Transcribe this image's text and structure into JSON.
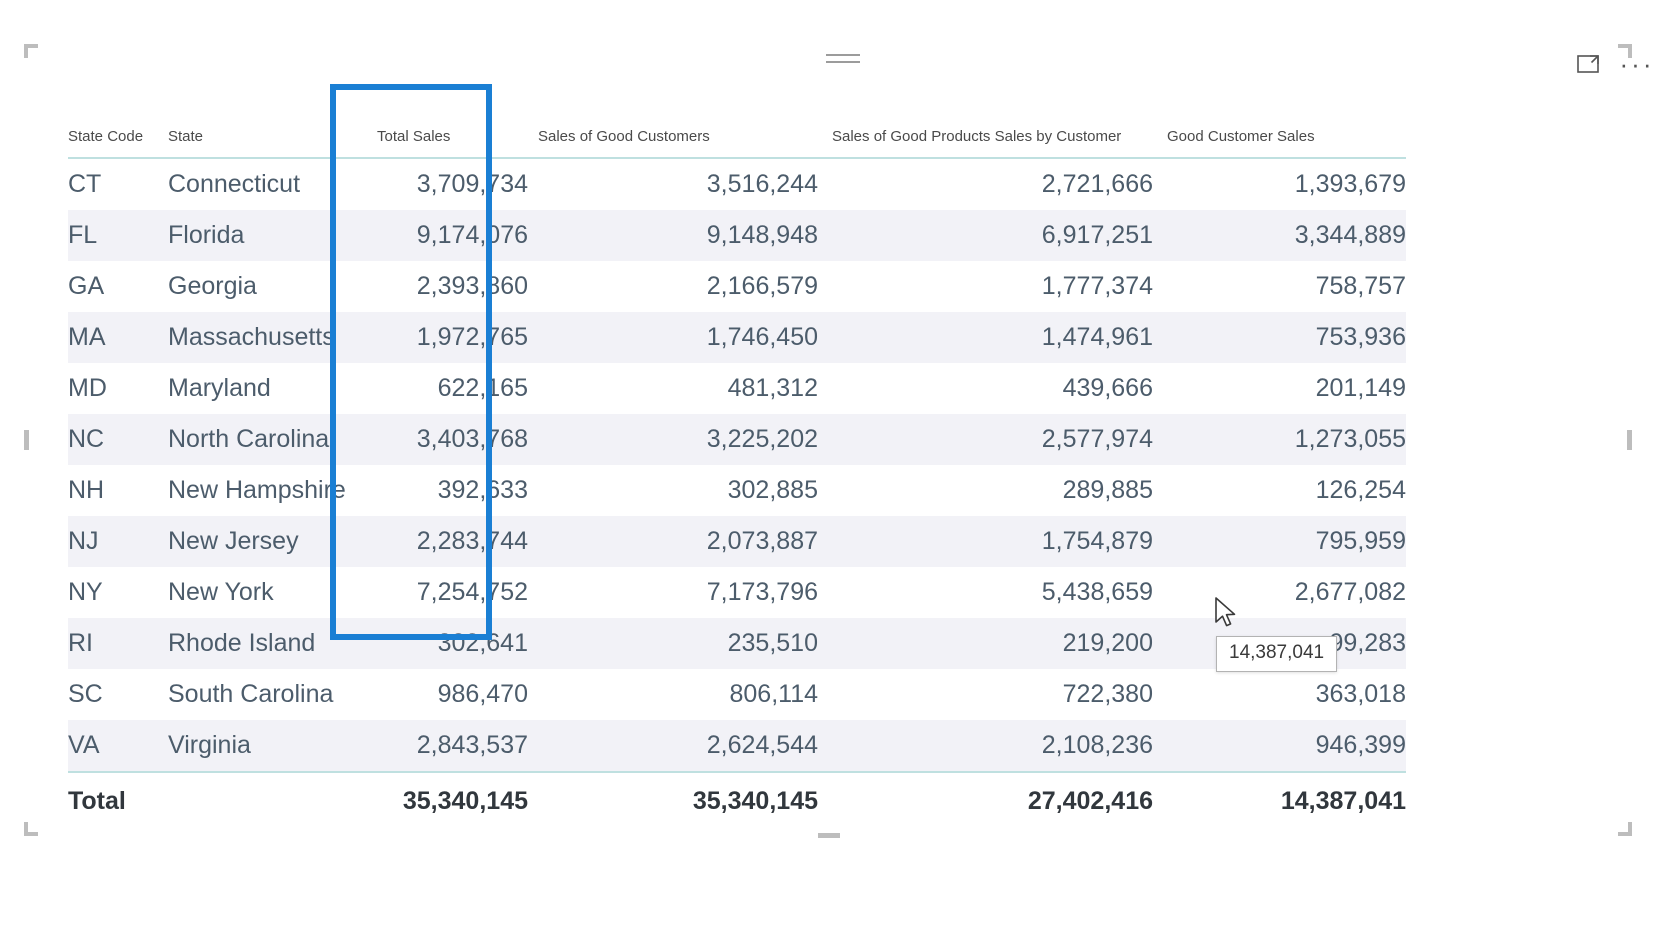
{
  "visual": {
    "drag_grip_name": "drag-handle",
    "focus_mode_label": "Focus mode",
    "more_options_label": "More options",
    "more_options_glyph": "···"
  },
  "table": {
    "columns": [
      {
        "key": "state_code",
        "label": "State Code",
        "align": "left"
      },
      {
        "key": "state",
        "label": "State",
        "align": "left"
      },
      {
        "key": "total_sales",
        "label": "Total Sales",
        "align": "right"
      },
      {
        "key": "sales_of_good_customers",
        "label": "Sales of Good Customers",
        "align": "right"
      },
      {
        "key": "sales_of_good_products_sales_by_customer",
        "label": "Sales of Good Products Sales by Customer",
        "align": "right"
      },
      {
        "key": "good_customer_sales",
        "label": "Good Customer Sales",
        "align": "right"
      }
    ],
    "rows": [
      {
        "state_code": "CT",
        "state": "Connecticut",
        "total_sales": "3,709,734",
        "sales_of_good_customers": "3,516,244",
        "sales_of_good_products_sales_by_customer": "2,721,666",
        "good_customer_sales": "1,393,679"
      },
      {
        "state_code": "FL",
        "state": "Florida",
        "total_sales": "9,174,076",
        "sales_of_good_customers": "9,148,948",
        "sales_of_good_products_sales_by_customer": "6,917,251",
        "good_customer_sales": "3,344,889"
      },
      {
        "state_code": "GA",
        "state": "Georgia",
        "total_sales": "2,393,860",
        "sales_of_good_customers": "2,166,579",
        "sales_of_good_products_sales_by_customer": "1,777,374",
        "good_customer_sales": "758,757"
      },
      {
        "state_code": "MA",
        "state": "Massachusetts",
        "total_sales": "1,972,765",
        "sales_of_good_customers": "1,746,450",
        "sales_of_good_products_sales_by_customer": "1,474,961",
        "good_customer_sales": "753,936"
      },
      {
        "state_code": "MD",
        "state": "Maryland",
        "total_sales": "622,165",
        "sales_of_good_customers": "481,312",
        "sales_of_good_products_sales_by_customer": "439,666",
        "good_customer_sales": "201,149"
      },
      {
        "state_code": "NC",
        "state": "North Carolina",
        "total_sales": "3,403,768",
        "sales_of_good_customers": "3,225,202",
        "sales_of_good_products_sales_by_customer": "2,577,974",
        "good_customer_sales": "1,273,055"
      },
      {
        "state_code": "NH",
        "state": "New Hampshire",
        "total_sales": "392,633",
        "sales_of_good_customers": "302,885",
        "sales_of_good_products_sales_by_customer": "289,885",
        "good_customer_sales": "126,254"
      },
      {
        "state_code": "NJ",
        "state": "New Jersey",
        "total_sales": "2,283,744",
        "sales_of_good_customers": "2,073,887",
        "sales_of_good_products_sales_by_customer": "1,754,879",
        "good_customer_sales": "795,959"
      },
      {
        "state_code": "NY",
        "state": "New York",
        "total_sales": "7,254,752",
        "sales_of_good_customers": "7,173,796",
        "sales_of_good_products_sales_by_customer": "5,438,659",
        "good_customer_sales": "2,677,082"
      },
      {
        "state_code": "RI",
        "state": "Rhode Island",
        "total_sales": "302,641",
        "sales_of_good_customers": "235,510",
        "sales_of_good_products_sales_by_customer": "219,200",
        "good_customer_sales": "99,283"
      },
      {
        "state_code": "SC",
        "state": "South Carolina",
        "total_sales": "986,470",
        "sales_of_good_customers": "806,114",
        "sales_of_good_products_sales_by_customer": "722,380",
        "good_customer_sales": "363,018"
      },
      {
        "state_code": "VA",
        "state": "Virginia",
        "total_sales": "2,843,537",
        "sales_of_good_customers": "2,624,544",
        "sales_of_good_products_sales_by_customer": "2,108,236",
        "good_customer_sales": "946,399"
      }
    ],
    "total_row": {
      "state_code": "Total",
      "state": "",
      "total_sales": "35,340,145",
      "sales_of_good_customers": "35,340,145",
      "sales_of_good_products_sales_by_customer": "27,402,416",
      "good_customer_sales": "14,387,041"
    }
  },
  "annotation": {
    "highlight_column": "Total Sales",
    "highlight_color": "#1a7fd4"
  },
  "tooltip": {
    "value": "14,387,041"
  },
  "colors": {
    "header_text": "#4a4a4a",
    "cell_text": "#4c5c6b",
    "total_text": "#31373d",
    "row_alt": "#f2f2f7",
    "rule": "#bfe0e0",
    "highlight": "#1a7fd4"
  }
}
